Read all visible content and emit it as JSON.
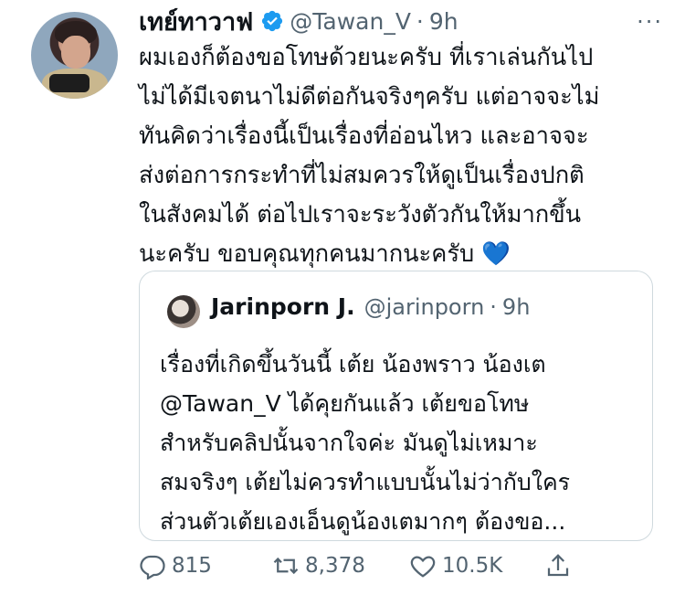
{
  "tweet": {
    "display_name": "เทย์ทาวาฟ",
    "handle": "@Tawan_V",
    "separator": "·",
    "time": "9h",
    "more": "···",
    "text_lines": [
      "ผมเองก็ต้องขอโทษด้วยนะครับ ที่เราเล่นกันไป",
      "ไม่ได้มีเจตนาไม่ดีต่อกันจริงๆครับ แต่อาจจะไม่",
      "ทันคิดว่าเรื่องนี้เป็นเรื่องที่อ่อนไหว และอาจจะ",
      "ส่งต่อการกระทำที่ไม่สมควรให้ดูเป็นเรื่องปกติ",
      "ในสังคมได้  ต่อไปเราจะระวังตัวกันให้มากขึ้น",
      "นะครับ ขอบคุณทุกคนมากนะครับ 💙"
    ]
  },
  "quote": {
    "display_name": "Jarinporn J.",
    "handle": "@jarinporn",
    "separator": "·",
    "time": "9h",
    "text_lines": [
      "เรื่องที่เกิดขึ้นวันนี้ เต้ย น้องพราว น้องเต",
      "@Tawan_V ได้คุยกันแล้ว เต้ยขอโทษ",
      "สำหรับคลิปนั้นจากใจค่ะ มันดูไม่เหมาะ",
      "สมจริงๆ เต้ยไม่ควรทำแบบนั้นไม่ว่ากับใคร",
      "ส่วนตัวเต้ยเองเอ็นดูน้องเตมากๆ ต้องขอ..."
    ]
  },
  "actions": {
    "replies": "815",
    "retweets": "8,378",
    "likes": "10.5K"
  },
  "colors": {
    "verified": "#1d9bf0",
    "muted": "#536471",
    "border": "#cfd9de"
  }
}
